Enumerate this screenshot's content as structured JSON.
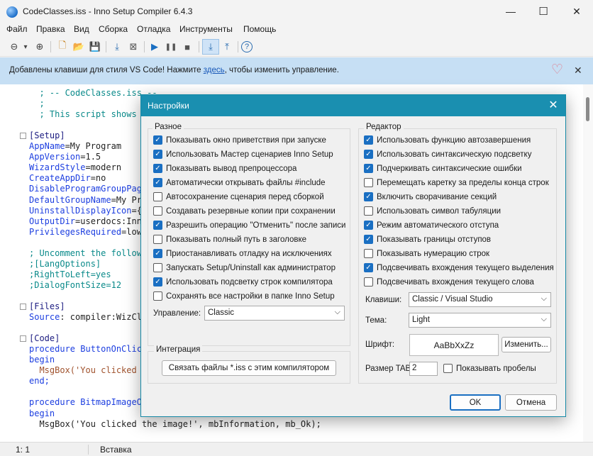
{
  "window": {
    "title": "CodeClasses.iss - Inno Setup Compiler 6.4.3",
    "minimize": "—",
    "maximize": "☐",
    "close": "✕"
  },
  "menu": [
    "Файл",
    "Правка",
    "Вид",
    "Сборка",
    "Отладка",
    "Инструменты",
    "Помощь"
  ],
  "toolbar": {
    "icons": [
      "back-icon",
      "dropdown-arrow-icon",
      "forward-icon",
      "new-file-icon",
      "open-file-icon",
      "save-icon",
      "compile-icon",
      "stop-compile-icon",
      "run-icon",
      "pause-icon",
      "stop-icon",
      "target-download-icon",
      "target-upload-icon",
      "help-icon"
    ],
    "glyphs": [
      "⊖",
      "▾",
      "⊕",
      "🗋",
      "📂",
      "💾",
      "⤓",
      "⊠",
      "▶",
      "❚❚",
      "■",
      "⤓",
      "⤒",
      "?"
    ]
  },
  "infobar": {
    "text_before": "Добавлены клавиши для стиля VS Code! Нажмите ",
    "link": "здесь",
    "text_after": ", чтобы изменить управление.",
    "heart": "♡",
    "close": "✕"
  },
  "editor": {
    "lines": [
      {
        "t": "  ; -- CodeClasses.iss --",
        "c": "c-comment"
      },
      {
        "t": "  ;",
        "c": "c-comment"
      },
      {
        "t": "  ; This script shows how",
        "c": "c-comment"
      },
      {
        "t": "",
        "c": "c-plain"
      },
      {
        "t": "[Setup]",
        "c": "c-section",
        "fold": true
      },
      {
        "k": "AppName",
        "v": "=My Program"
      },
      {
        "k": "AppVersion",
        "v": "=1.5"
      },
      {
        "k": "WizardStyle",
        "v": "=modern"
      },
      {
        "k": "CreateAppDir",
        "v": "=no"
      },
      {
        "k": "DisableProgramGroupPage",
        "v": ""
      },
      {
        "k": "DefaultGroupName",
        "v": "=My Pro"
      },
      {
        "k": "UninstallDisplayIcon",
        "v": "={a"
      },
      {
        "k": "OutputDir",
        "v": "=userdocs:Inno"
      },
      {
        "k": "PrivilegesRequired",
        "v": "=lowe"
      },
      {
        "t": "",
        "c": "c-plain"
      },
      {
        "t": "; Uncomment the followi",
        "c": "c-comment"
      },
      {
        "t": ";[LangOptions]",
        "c": "c-comment"
      },
      {
        "t": ";RightToLeft=yes",
        "c": "c-comment"
      },
      {
        "t": ";DialogFontSize=12",
        "c": "c-comment"
      },
      {
        "t": "",
        "c": "c-plain"
      },
      {
        "t": "[Files]",
        "c": "c-section",
        "fold": true
      },
      {
        "k": "Source",
        "v": ": compiler:WizCla"
      },
      {
        "t": "",
        "c": "c-plain"
      },
      {
        "t": "[Code]",
        "c": "c-section",
        "fold": true
      },
      {
        "t": "procedure ButtonOnClick",
        "c": "c-kw"
      },
      {
        "t": "begin",
        "c": "c-kw"
      },
      {
        "t": "  MsgBox('You clicked t",
        "c": "c-str"
      },
      {
        "t": "end;",
        "c": "c-kw"
      },
      {
        "t": "",
        "c": "c-plain"
      },
      {
        "t": "procedure BitmapImageOn",
        "c": "c-kw"
      },
      {
        "t": "begin",
        "c": "c-kw"
      },
      {
        "t": "  MsgBox('You clicked the image!', mbInformation, mb_Ok);",
        "c": "c-plain"
      }
    ]
  },
  "status": {
    "position": "1:  1",
    "mode": "Вставка"
  },
  "dialog": {
    "title": "Настройки",
    "close": "✕",
    "misc": {
      "label": "Разное",
      "items": [
        {
          "label": "Показывать окно приветствия при запуске",
          "checked": true
        },
        {
          "label": "Использовать Мастер сценариев Inno Setup",
          "checked": true
        },
        {
          "label": "Показывать вывод препроцессора",
          "checked": true
        },
        {
          "label": "Автоматически открывать файлы #include",
          "checked": true
        },
        {
          "label": "Автосохранение сценария перед сборкой",
          "checked": false
        },
        {
          "label": "Создавать резервные копии при сохранении",
          "checked": false
        },
        {
          "label": "Разрешить операцию \"Отменить\" после записи",
          "checked": true
        },
        {
          "label": "Показывать полный путь в заголовке",
          "checked": false
        },
        {
          "label": "Приостанавливать отладку на исключениях",
          "checked": true
        },
        {
          "label": "Запускать Setup/Uninstall как администратор",
          "checked": false
        },
        {
          "label": "Использовать подсветку строк компилятора",
          "checked": true
        },
        {
          "label": "Сохранять все настройки в папке Inno Setup",
          "checked": false
        }
      ],
      "control_label": "Управление:",
      "control_value": "Classic"
    },
    "integration": {
      "label": "Интеграция",
      "button": "Связать файлы *.iss с этим компилятором"
    },
    "editor": {
      "label": "Редактор",
      "items": [
        {
          "label": "Использовать функцию автозавершения",
          "checked": true
        },
        {
          "label": "Использовать синтаксическую подсветку",
          "checked": true
        },
        {
          "label": "Подчеркивать синтаксические ошибки",
          "checked": true
        },
        {
          "label": "Перемещать каретку за пределы конца строк",
          "checked": false
        },
        {
          "label": "Включить сворачивание секций",
          "checked": true
        },
        {
          "label": "Использовать символ табуляции",
          "checked": false
        },
        {
          "label": "Режим автоматического отступа",
          "checked": true
        },
        {
          "label": "Показывать границы отступов",
          "checked": true
        },
        {
          "label": "Показывать нумерацию строк",
          "checked": false
        },
        {
          "label": "Подсвечивать вхождения текущего выделения",
          "checked": true
        },
        {
          "label": "Подсвечивать вхождения текущего слова",
          "checked": false
        }
      ],
      "keys_label": "Клавиши:",
      "keys_value": "Classic / Visual Studio",
      "theme_label": "Тема:",
      "theme_value": "Light",
      "font_label": "Шрифт:",
      "font_sample": "AaBbXxZz",
      "change_button": "Изменить...",
      "tab_label": "Размер TAB:",
      "tab_value": "2",
      "show_spaces_label": "Показывать пробелы",
      "show_spaces_checked": false
    },
    "ok": "OK",
    "cancel": "Отмена"
  }
}
